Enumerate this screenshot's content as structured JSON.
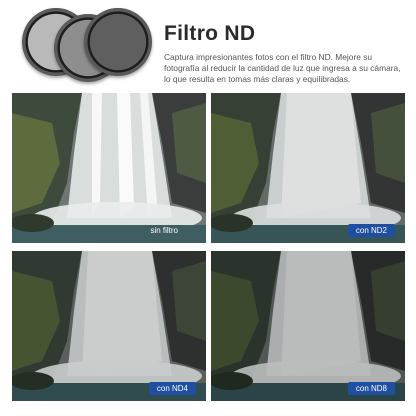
{
  "header": {
    "title": "Filtro ND",
    "description": "Captura impresionantes fotos con el filtro ND. Mejore su fotografía al reducir la cantidad de luz que ingresa a su cámara, lo que resulta en tomas más claras y equilibradas."
  },
  "filters": {
    "icon": "nd-filter-set-image"
  },
  "photos": [
    {
      "label": "sin filtro"
    },
    {
      "label": "con ND2"
    },
    {
      "label": "con ND4"
    },
    {
      "label": "con ND8"
    }
  ],
  "colors": {
    "badge": "#1f4fa0",
    "title": "#2b2b2b"
  }
}
